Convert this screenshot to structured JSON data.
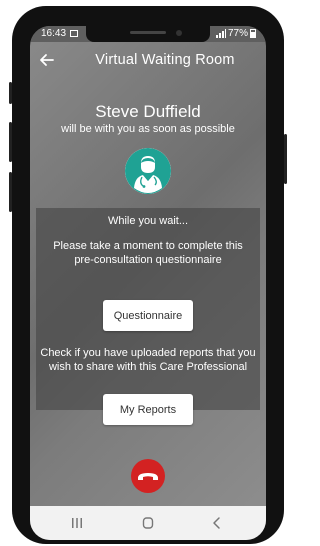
{
  "status_bar": {
    "time": "16:43",
    "battery_percent": "77%"
  },
  "header": {
    "title": "Virtual Waiting Room",
    "back_icon": "arrow-left-icon"
  },
  "doctor": {
    "name": "Steve Duffield",
    "subtitle": "will be with you as soon as possible",
    "avatar_icon": "doctor-icon"
  },
  "wait_panel": {
    "intro": "While you wait...",
    "questionnaire_prompt": "Please take a moment to complete this pre-consultation questionnaire",
    "questionnaire_button": "Questionnaire",
    "reports_prompt": "Check if you have uploaded reports that you wish to share with this Care Professional",
    "reports_button": "My Reports"
  },
  "call": {
    "end_icon": "phone-hangup-icon"
  },
  "nav_bar": {
    "recent_icon": "recent-apps-icon",
    "home_icon": "home-icon",
    "back_icon": "back-chevron-icon"
  },
  "colors": {
    "accent": "#1fa294",
    "end_call": "#d32222",
    "panel": "#464646"
  }
}
